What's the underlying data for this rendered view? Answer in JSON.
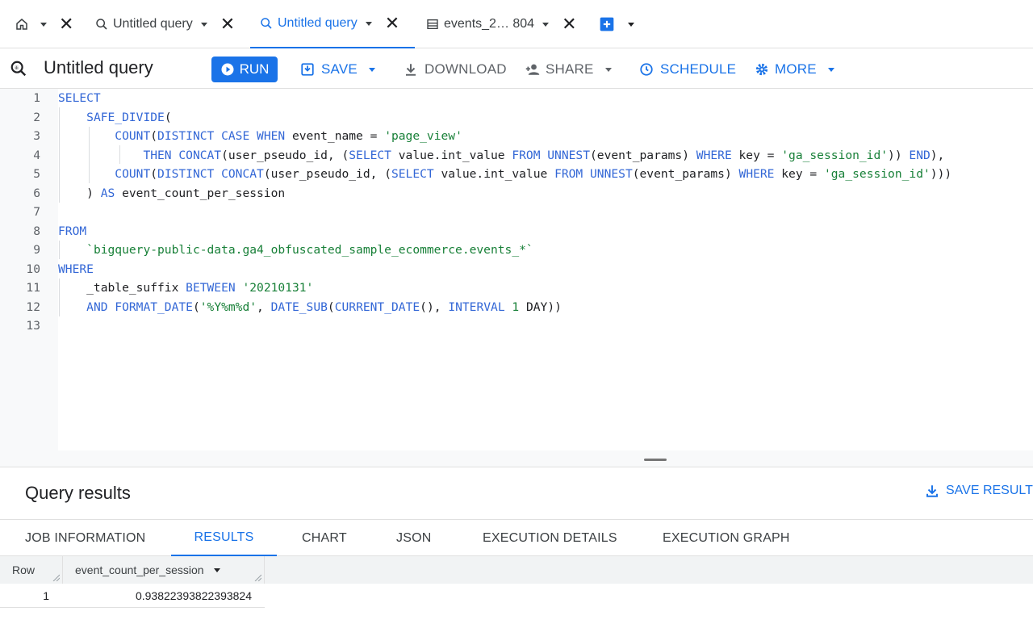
{
  "tabs": [
    {
      "label": "Untitled query"
    },
    {
      "label": "Untitled query"
    },
    {
      "label": "events_2… 804"
    }
  ],
  "toolbar": {
    "title": "Untitled query",
    "run": "RUN",
    "save": "SAVE",
    "download": "DOWNLOAD",
    "share": "SHARE",
    "schedule": "SCHEDULE",
    "more": "MORE"
  },
  "editor": {
    "line_numbers": [
      "1",
      "2",
      "3",
      "4",
      "5",
      "6",
      "7",
      "8",
      "9",
      "10",
      "11",
      "12",
      "13"
    ]
  },
  "results": {
    "title": "Query results",
    "save_results": "SAVE RESULTS",
    "tabs": [
      "JOB INFORMATION",
      "RESULTS",
      "CHART",
      "JSON",
      "EXECUTION DETAILS",
      "EXECUTION GRAPH"
    ],
    "active_tab": "RESULTS",
    "columns": [
      "Row",
      "event_count_per_session"
    ],
    "rows": [
      {
        "row": "1",
        "value": "0.93822393822393824"
      }
    ]
  },
  "colors": {
    "accent": "#1a73e8",
    "keyword": "#3367d6",
    "string": "#188038"
  }
}
